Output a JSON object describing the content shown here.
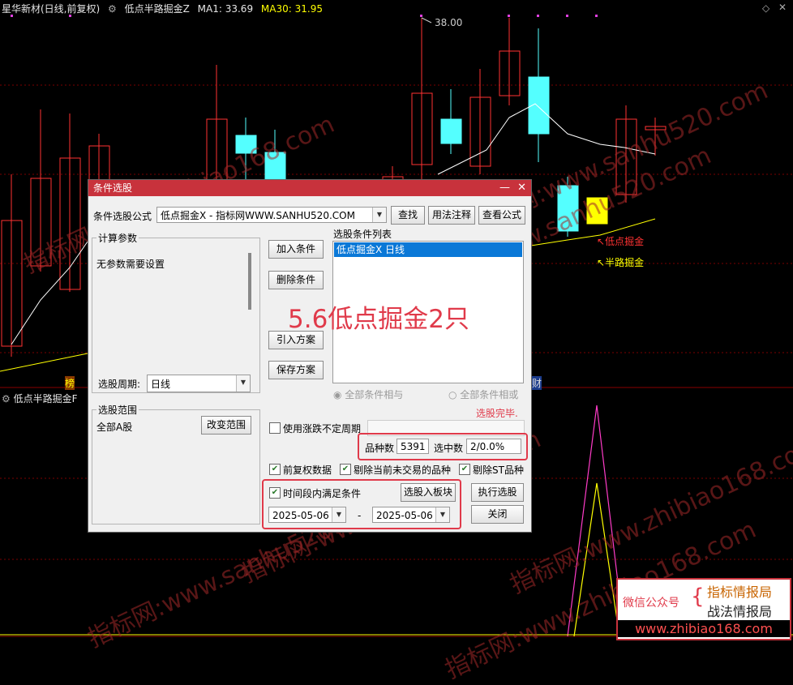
{
  "header": {
    "stock": "星华新材(日线,前复权)",
    "indicator": "低点半路掘金Z",
    "ma1_label": "MA1: 33.69",
    "ma30_label": "MA30: 31.95",
    "high_price": "38.00",
    "lower_indicator": "低点半路掘金F"
  },
  "annotations": {
    "low_point": "低点掘金",
    "halfway": "半路掘金",
    "left_marker": "榜",
    "right_marker": "财"
  },
  "colors": {
    "up_candle": "#ff3232",
    "down_candle": "#54ffff",
    "signal_candle": "#ffff00",
    "ma_line": "#ffffff",
    "ma30_line": "#ffff00",
    "grid": "#7a0000",
    "dialog_title": "#c8323c"
  },
  "dialog": {
    "title": "条件选股",
    "formula_label": "条件选股公式",
    "formula_value": "低点掘金X   - 指标网WWW.SANHU520.COM",
    "btn_find": "查找",
    "btn_usage": "用法注释",
    "btn_view": "查看公式",
    "params_group": "计算参数",
    "params_text": "无参数需要设置",
    "period_label": "选股周期:",
    "period_value": "日线",
    "btn_add": "加入条件",
    "btn_delete": "删除条件",
    "btn_import": "引入方案",
    "btn_save": "保存方案",
    "cond_list_label": "选股条件列表",
    "cond_item": "低点掘金X  日线",
    "overlay_text": "5.6低点掘金2只",
    "radio_and": "全部条件相与",
    "radio_or": "全部条件相或",
    "status": "选股完毕.",
    "range_group": "选股范围",
    "range_value": "全部A股",
    "btn_change_range": "改变范围",
    "use_irregular": "使用涨跌不定周期",
    "count_label": "品种数",
    "count_value": "5391",
    "selected_label": "选中数",
    "selected_value": "2/0.0%",
    "chk_fq": "前复权数据",
    "chk_remove_notrade": "剔除当前未交易的品种",
    "chk_remove_st": "剔除ST品种",
    "chk_timerange": "时间段内满足条件",
    "btn_to_block": "选股入板块",
    "btn_execute": "执行选股",
    "date_from": "2025-05-06",
    "date_dash": "-",
    "date_to": "2025-05-06",
    "btn_close": "关闭"
  },
  "watermarks": [
    "指标网:www.zhibiao168.com",
    "指标网:www.sanhu520.com",
    "指标网:www.sanhu520.com",
    "指标网:www.zhibiao168.com",
    "指标网:www.sanhu520.com",
    "指标网:www.zhibiao168.com",
    "指标网:www.sanhu520.com"
  ],
  "promo": {
    "wechat": "微信公众号",
    "line1": "指标情报局",
    "line2": "战法情报局",
    "url": "www.zhibiao168.com"
  }
}
